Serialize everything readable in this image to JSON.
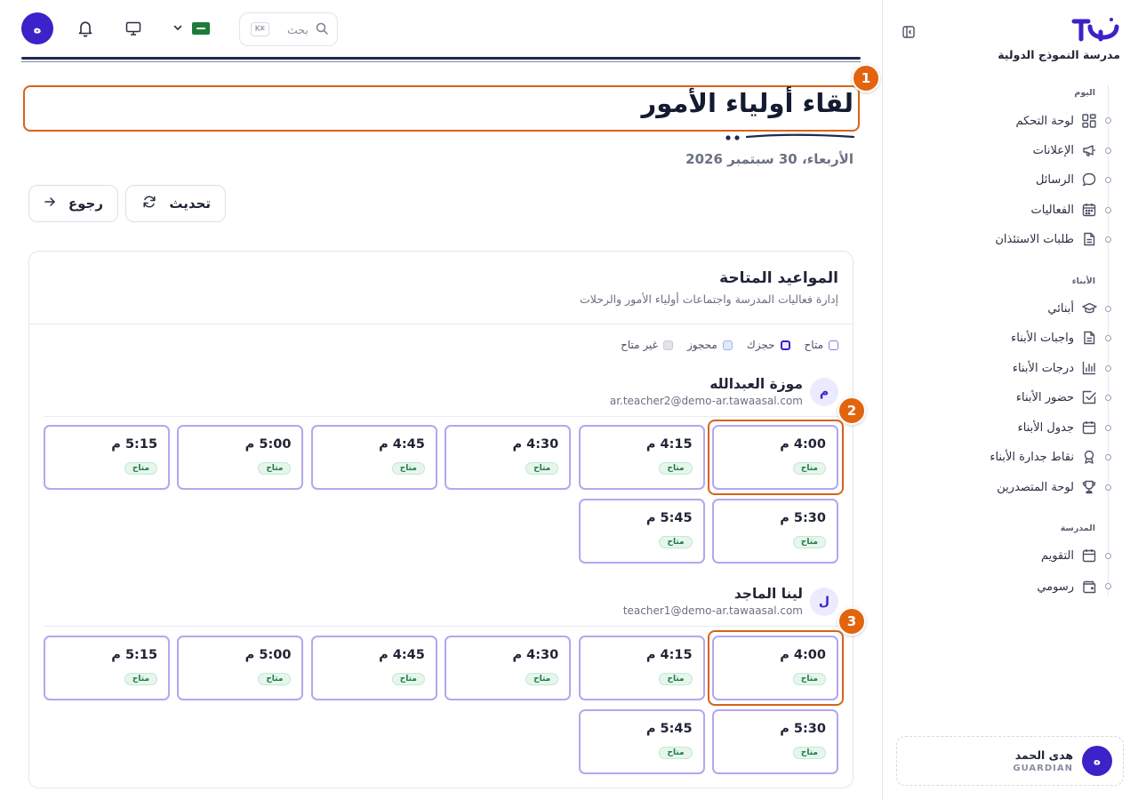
{
  "sidebar": {
    "school_name": "مدرسة النموذج الدولية",
    "sections": [
      {
        "label": "اليوم",
        "items": [
          {
            "label": "لوحة التحكم",
            "icon": "dashboard-icon"
          },
          {
            "label": "الإعلانات",
            "icon": "megaphone-icon"
          },
          {
            "label": "الرسائل",
            "icon": "chat-icon"
          },
          {
            "label": "الفعاليات",
            "icon": "calendar-grid-icon"
          },
          {
            "label": "طلبات الاستئذان",
            "icon": "document-icon"
          }
        ]
      },
      {
        "label": "الأبناء",
        "items": [
          {
            "label": "أبنائي",
            "icon": "graduation-cap-icon"
          },
          {
            "label": "واجبات الأبناء",
            "icon": "document-icon"
          },
          {
            "label": "درجات الأبناء",
            "icon": "bar-chart-icon"
          },
          {
            "label": "حضور الأبناء",
            "icon": "check-square-icon"
          },
          {
            "label": "جدول الأبناء",
            "icon": "calendar-icon"
          },
          {
            "label": "نقاط جدارة الأبناء",
            "icon": "award-icon"
          },
          {
            "label": "لوحة المتصدرين",
            "icon": "trophy-icon"
          }
        ]
      },
      {
        "label": "المدرسة",
        "items": [
          {
            "label": "التقويم",
            "icon": "calendar-icon"
          },
          {
            "label": "رسومي",
            "icon": "wallet-icon"
          }
        ]
      }
    ],
    "user": {
      "initial": "ه",
      "name": "هدى الحمد",
      "role": "GUARDIAN"
    }
  },
  "topbar": {
    "avatar_initial": "ه",
    "search_placeholder": "بحث",
    "search_shortcut": "K⌘"
  },
  "page": {
    "title": "لقاء أولياء الأمور",
    "date": "الأربعاء، 30 سبتمبر 2026",
    "refresh_label": "تحديث",
    "back_label": "رجوع"
  },
  "callouts": [
    "1",
    "2",
    "3"
  ],
  "card": {
    "title": "المواعيد المتاحة",
    "subtitle": "إدارة فعاليات المدرسة واجتماعات أولياء الأمور والرحلات",
    "legend": [
      {
        "label": "متاح",
        "color": "#ffffff",
        "border": "#8b7be8"
      },
      {
        "label": "حجزك",
        "color": "#eceaff",
        "border": "#3b22c9"
      },
      {
        "label": "محجوز",
        "color": "#dfe9fb",
        "border": "#9fb8e6"
      },
      {
        "label": "غير متاح",
        "color": "#e4e4e8",
        "border": "#c9cad2"
      }
    ],
    "teachers": [
      {
        "initial": "م",
        "name": "موزة العبدالله",
        "email": "ar.teacher2@demo-ar.tawaasal.com",
        "slots": [
          {
            "time": "4:00 م",
            "status": "متاح"
          },
          {
            "time": "4:15 م",
            "status": "متاح"
          },
          {
            "time": "4:30 م",
            "status": "متاح"
          },
          {
            "time": "4:45 م",
            "status": "متاح"
          },
          {
            "time": "5:00 م",
            "status": "متاح"
          },
          {
            "time": "5:15 م",
            "status": "متاح"
          },
          {
            "time": "5:30 م",
            "status": "متاح"
          },
          {
            "time": "5:45 م",
            "status": "متاح"
          }
        ]
      },
      {
        "initial": "ل",
        "name": "لينا الماجد",
        "email": "teacher1@demo-ar.tawaasal.com",
        "slots": [
          {
            "time": "4:00 م",
            "status": "متاح"
          },
          {
            "time": "4:15 م",
            "status": "متاح"
          },
          {
            "time": "4:30 م",
            "status": "متاح"
          },
          {
            "time": "4:45 م",
            "status": "متاح"
          },
          {
            "time": "5:00 م",
            "status": "متاح"
          },
          {
            "time": "5:15 م",
            "status": "متاح"
          },
          {
            "time": "5:30 م",
            "status": "متاح"
          },
          {
            "time": "5:45 م",
            "status": "متاح"
          }
        ]
      }
    ]
  },
  "colors": {
    "brand": "#3b22c9",
    "accent": "#d8621a",
    "available_border": "#b3a7ef"
  }
}
